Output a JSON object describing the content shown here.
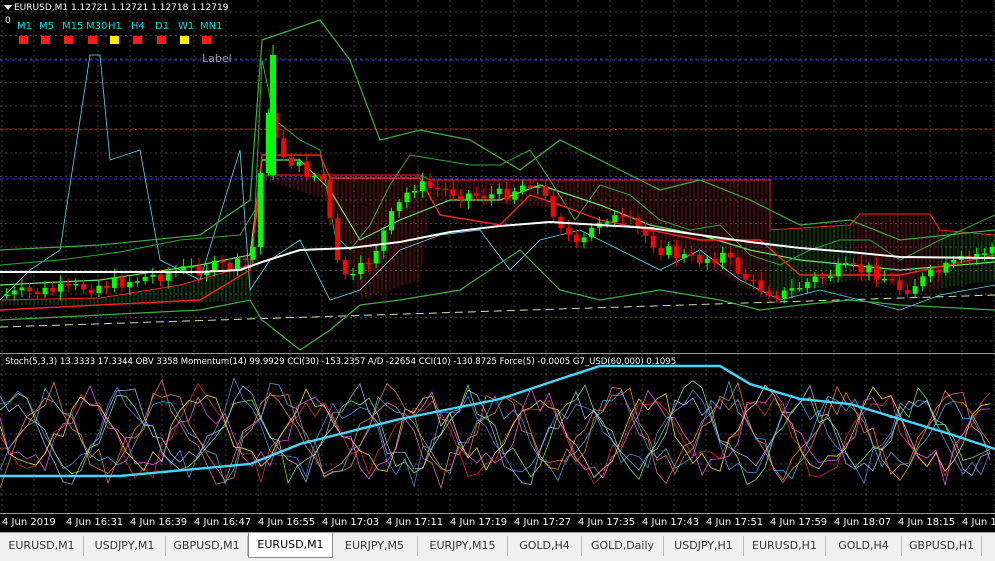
{
  "chart_title": "EURUSD,M1  1.12721 1.12721 1.12718 1.12719",
  "zero_label": "0",
  "label_text": "Label",
  "timeframes": [
    {
      "label": "M1",
      "color": "#ff1a1a"
    },
    {
      "label": "M5",
      "color": "#ff1a1a"
    },
    {
      "label": "M15",
      "color": "#ff1a1a"
    },
    {
      "label": "M30",
      "color": "#ff1a1a"
    },
    {
      "label": "H1",
      "color": "#ffee00"
    },
    {
      "label": "H4",
      "color": "#ff1a1a"
    },
    {
      "label": "D1",
      "color": "#ff1a1a"
    },
    {
      "label": "W1",
      "color": "#ffee00"
    },
    {
      "label": "MN1",
      "color": "#ff1a1a"
    }
  ],
  "indicator_header": "Stoch(5,3,3) 13.3333 17.3344  OBV 3358  Momentum(14) 99.9929  CCI(30) -153.2357  A/D -22654  CCI(10) -130.8725  Force(5) -0.0005  G7_USD(60,000) 0.1095",
  "time_ticks": [
    "4 Jun 2019",
    "4 Jun 16:31",
    "4 Jun 16:39",
    "4 Jun 16:47",
    "4 Jun 16:55",
    "4 Jun 17:03",
    "4 Jun 17:11",
    "4 Jun 17:19",
    "4 Jun 17:27",
    "4 Jun 17:35",
    "4 Jun 17:43",
    "4 Jun 17:51",
    "4 Jun 17:59",
    "4 Jun 18:07",
    "4 Jun 18:15",
    "4 Jun 18:2"
  ],
  "tabs": [
    {
      "label": "EURUSD,M1",
      "active": false
    },
    {
      "label": "USDJPY,M1",
      "active": false
    },
    {
      "label": "GBPUSD,M1",
      "active": false
    },
    {
      "label": "EURUSD,M1",
      "active": true
    },
    {
      "label": "EURJPY,M5",
      "active": false
    },
    {
      "label": "EURJPY,M15",
      "active": false
    },
    {
      "label": "GOLD,H4",
      "active": false
    },
    {
      "label": "GOLD,Daily",
      "active": false
    },
    {
      "label": "USDJPY,H1",
      "active": false
    },
    {
      "label": "EURUSD,H1",
      "active": false
    },
    {
      "label": "GOLD,H4",
      "active": false
    },
    {
      "label": "GBPUSD,H1",
      "active": false
    }
  ],
  "colors": {
    "bull": "#00ff00",
    "bear": "#ff0000",
    "ma_white": "#ffffff",
    "bands": "#3cb043",
    "cyan": "#5bd8f0",
    "kumo_red": "#ff2020",
    "kumo_green": "#18c018"
  }
}
